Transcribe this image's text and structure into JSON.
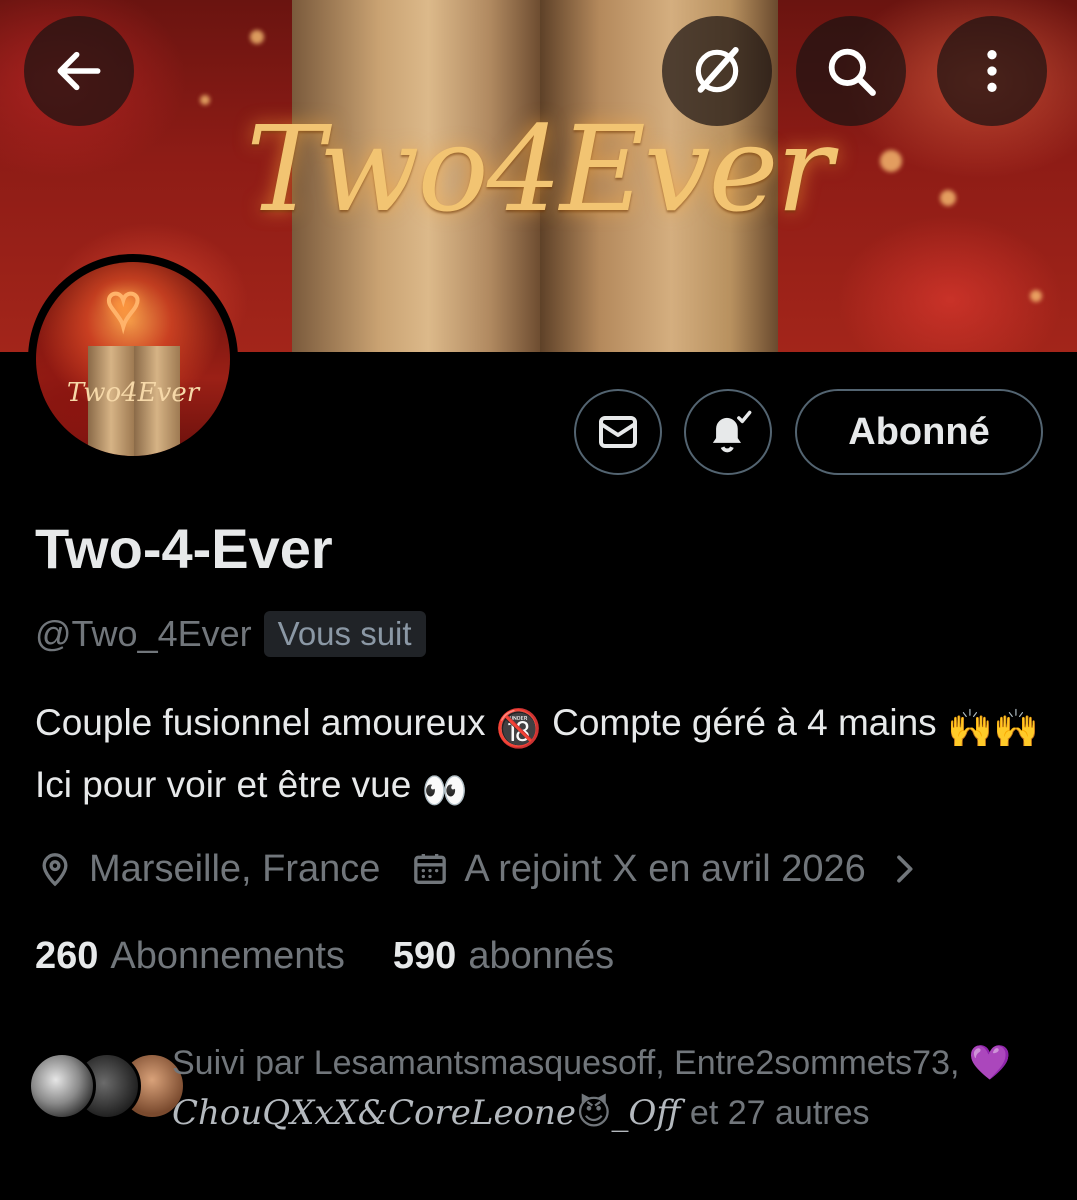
{
  "banner": {
    "title": "Two4Ever"
  },
  "top_bar": {
    "back_icon": "arrow-left-icon",
    "grok_icon": "grok-icon",
    "search_icon": "search-icon",
    "more_icon": "more-vertical-icon"
  },
  "avatar": {
    "text": "Two4Ever"
  },
  "actions": {
    "message_icon": "mail-icon",
    "notification_icon": "bell-check-icon",
    "follow_label": "Abonné"
  },
  "profile": {
    "display_name": "Two-4-Ever",
    "handle": "@Two_4Ever",
    "follows_you": "Vous suit",
    "bio_part1": "Couple fusionnel amoureux",
    "bio_emoji1": "🔞",
    "bio_part2": " Compte géré à 4 mains",
    "bio_emoji2": "🙌🙌",
    "bio_part3": " Ici pour voir et être vue",
    "bio_emoji3": "👀",
    "location": "Marseille, France",
    "joined": "A rejoint X en avril 2026"
  },
  "stats": {
    "following_count": "260",
    "following_label": "Abonnements",
    "followers_count": "590",
    "followers_label": "abonnés"
  },
  "followed_by": {
    "prefix": "Suivi par Lesamantsmasquesoff, Entre2sommets73,",
    "heart": "💜",
    "fancy_name": "ChouQXxX&CoreLeone",
    "devil": "😈",
    "fancy_suffix": "_Off",
    "suffix": " et 27 autres"
  },
  "colors": {
    "background": "#000000",
    "primary_text": "#e7e9ea",
    "secondary_text": "#71767b",
    "border": "#536471"
  }
}
